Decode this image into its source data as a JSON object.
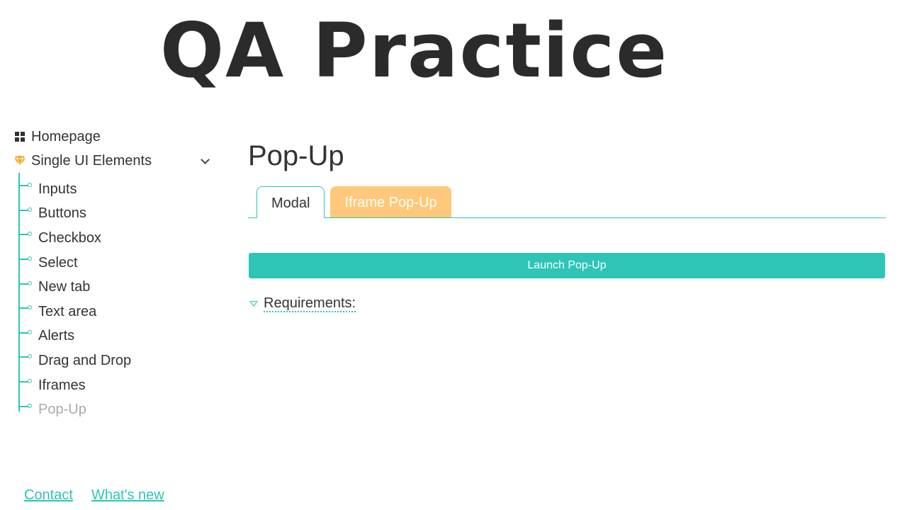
{
  "logo": {
    "text": "QA Practice"
  },
  "sidebar": {
    "homepage_label": "Homepage",
    "section_label": "Single UI Elements",
    "items": [
      {
        "label": "Inputs"
      },
      {
        "label": "Buttons"
      },
      {
        "label": "Checkbox"
      },
      {
        "label": "Select"
      },
      {
        "label": "New tab"
      },
      {
        "label": "Text area"
      },
      {
        "label": "Alerts"
      },
      {
        "label": "Drag and Drop"
      },
      {
        "label": "Iframes"
      },
      {
        "label": "Pop-Up"
      }
    ],
    "active_item": "Pop-Up"
  },
  "main": {
    "title": "Pop-Up",
    "tabs": [
      {
        "label": "Modal",
        "active": true
      },
      {
        "label": "Iframe Pop-Up",
        "active": false
      }
    ],
    "launch_button_label": "Launch Pop-Up",
    "requirements_label": "Requirements:"
  },
  "footer": {
    "contact_label": "Contact",
    "whats_new_label": "What's new"
  },
  "colors": {
    "accent": "#2ec4b6",
    "inactive_tab": "#ffc87a",
    "diamond_icon": "#f5a623",
    "text": "#333333",
    "active_nav_text": "#aaaaaa"
  }
}
